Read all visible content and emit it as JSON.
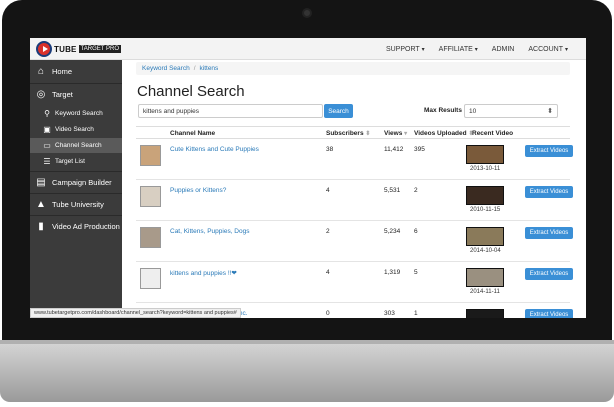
{
  "topbar": {
    "logo_text": "TUBE",
    "logo_pro": "TARGET PRO",
    "nav": [
      {
        "label": "SUPPORT",
        "caret": "▾"
      },
      {
        "label": "AFFILIATE",
        "caret": "▾"
      },
      {
        "label": "ADMIN",
        "caret": ""
      },
      {
        "label": "ACCOUNT",
        "caret": "▾"
      }
    ]
  },
  "sidebar": {
    "items": [
      {
        "label": "Home",
        "icon": "home-icon"
      },
      {
        "label": "Target",
        "icon": "target-icon"
      },
      {
        "label": "Keyword Search",
        "icon": "search-icon"
      },
      {
        "label": "Video Search",
        "icon": "video-search-icon"
      },
      {
        "label": "Channel Search",
        "icon": "tv-icon"
      },
      {
        "label": "Target List",
        "icon": "list-icon"
      },
      {
        "label": "Campaign Builder",
        "icon": "campaign-icon"
      },
      {
        "label": "Tube University",
        "icon": "university-icon"
      },
      {
        "label": "Video Ad Production",
        "icon": "video-icon"
      }
    ]
  },
  "breadcrumb": {
    "items": [
      "Keyword Search",
      "kittens"
    ],
    "separator": "/"
  },
  "page_title": "Channel Search",
  "search": {
    "value": "kittens and puppies",
    "button": "Search"
  },
  "max_results": {
    "label": "Max Results",
    "value": "10",
    "caret": "⬍"
  },
  "table": {
    "headers": {
      "channel": "Channel Name",
      "subscribers": "Subscribers",
      "views": "Views",
      "uploaded": "Videos Uploaded",
      "recent": "Recent Video"
    },
    "sort_glyph": "⬍",
    "sort_active_glyph": "▾",
    "rows": [
      {
        "name": "Cute Kittens and Cute Puppies",
        "subscribers": "38",
        "views": "11,412",
        "uploaded": "395",
        "date": "2013-10-11",
        "button": "Extract Videos"
      },
      {
        "name": "Puppies or Kittens?",
        "subscribers": "4",
        "views": "5,531",
        "uploaded": "2",
        "date": "2010-11-15",
        "button": "Extract Videos"
      },
      {
        "name": "Cat, Kittens, Puppies, Dogs",
        "subscribers": "2",
        "views": "5,234",
        "uploaded": "6",
        "date": "2014-10-04",
        "button": "Extract Videos"
      },
      {
        "name": "kittens and puppies !!❤",
        "subscribers": "4",
        "views": "1,319",
        "uploaded": "5",
        "date": "2014-11-11",
        "button": "Extract Videos"
      },
      {
        "name": "s Inc.",
        "subscribers": "0",
        "views": "303",
        "uploaded": "1",
        "date": "",
        "button": "Extract Videos"
      }
    ]
  },
  "statusbar": "www.tubetargetpro.com/dashboard/channel_search?keyword=kittens and puppies#",
  "colors": {
    "accent": "#3a8fd6",
    "sidebar": "#3b3b3b",
    "link": "#2a7ab8"
  }
}
